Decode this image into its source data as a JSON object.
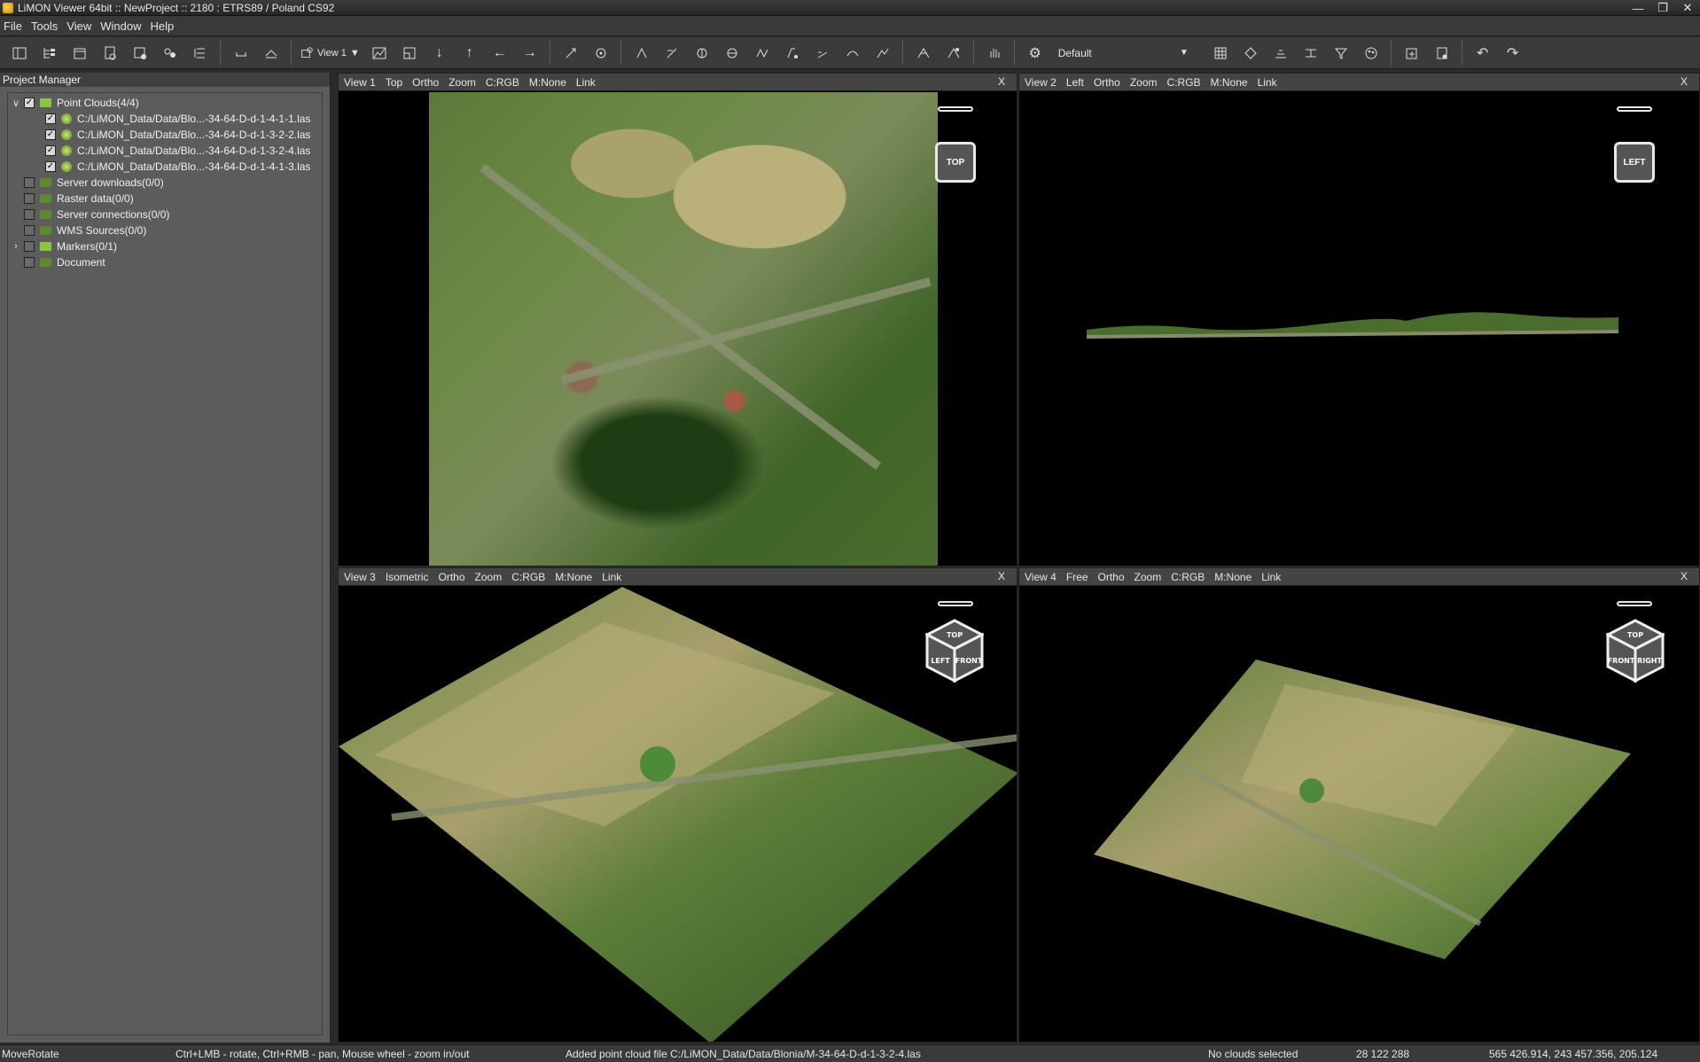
{
  "window": {
    "title": "LiMON Viewer 64bit :: NewProject :: 2180 : ETRS89 / Poland CS92",
    "buttons": [
      "minimize",
      "restore",
      "close"
    ]
  },
  "menu": [
    "File",
    "Tools",
    "View",
    "Window",
    "Help"
  ],
  "toolbar": {
    "view_selector": "View 1",
    "default_selector": "Default"
  },
  "project_manager": {
    "title": "Project Manager",
    "items": [
      {
        "label": "Point Clouds(4/4)",
        "expanded": true,
        "checked": true
      },
      {
        "label": "C:/LiMON_Data/Data/Blo...-34-64-D-d-1-4-1-1.las",
        "checked": true
      },
      {
        "label": "C:/LiMON_Data/Data/Blo...-34-64-D-d-1-3-2-2.las",
        "checked": true
      },
      {
        "label": "C:/LiMON_Data/Data/Blo...-34-64-D-d-1-3-2-4.las",
        "checked": true
      },
      {
        "label": "C:/LiMON_Data/Data/Blo...-34-64-D-d-1-4-1-3.las",
        "checked": true
      },
      {
        "label": "Server downloads(0/0)",
        "checked": false
      },
      {
        "label": "Raster data(0/0)",
        "checked": false
      },
      {
        "label": "Server connections(0/0)",
        "checked": false
      },
      {
        "label": "WMS Sources(0/0)",
        "checked": false
      },
      {
        "label": "Markers(0/1)",
        "checked": false,
        "expandable": true
      },
      {
        "label": "Document",
        "checked": false
      }
    ]
  },
  "views": [
    {
      "name": "View 1",
      "mode": "Top",
      "proj": "Ortho",
      "zoom": "Zoom",
      "color": "C:RGB",
      "marker": "M:None",
      "link": "Link",
      "close": "X",
      "nav": "TOP"
    },
    {
      "name": "View 2",
      "mode": "Left",
      "proj": "Ortho",
      "zoom": "Zoom",
      "color": "C:RGB",
      "marker": "M:None",
      "link": "Link",
      "close": "X",
      "nav": "LEFT"
    },
    {
      "name": "View 3",
      "mode": "Isometric",
      "proj": "Ortho",
      "zoom": "Zoom",
      "color": "C:RGB",
      "marker": "M:None",
      "link": "Link",
      "close": "X",
      "cube": [
        "TOP",
        "LEFT",
        "FRONT"
      ]
    },
    {
      "name": "View 4",
      "mode": "Free",
      "proj": "Ortho",
      "zoom": "Zoom",
      "color": "C:RGB",
      "marker": "M:None",
      "link": "Link",
      "close": "X",
      "cube": [
        "TOP",
        "FRONT",
        "RIGHT"
      ]
    }
  ],
  "status": {
    "mode": "MoveRotate",
    "hint": "Ctrl+LMB - rotate, Ctrl+RMB - pan, Mouse wheel - zoom in/out",
    "message": "Added point cloud file C:/LiMON_Data/Data/Blonia/M-34-64-D-d-1-3-2-4.las",
    "selection": "No clouds selected",
    "points": "28 122 288",
    "coords": "565 426.914, 243 457.356, 205.124"
  },
  "colors": {
    "background": "#2b2b2b",
    "panel": "#5c5c5c",
    "accent_folder": "#8cc63f"
  }
}
